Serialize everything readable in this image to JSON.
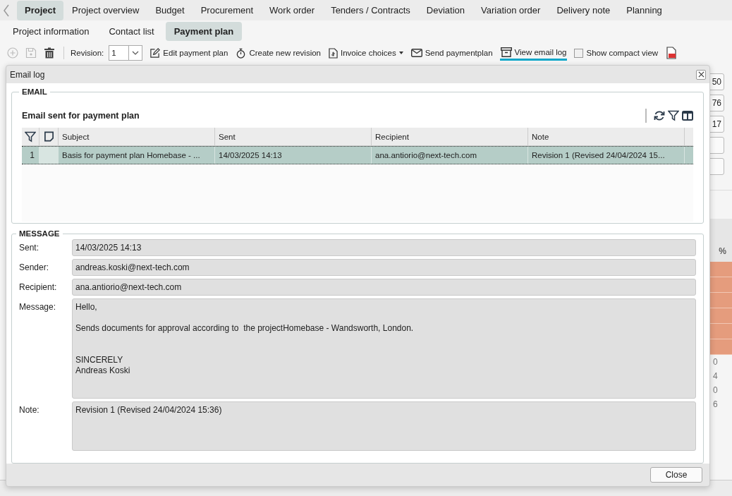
{
  "nav_tabs": [
    {
      "label": "Project",
      "selected": true
    },
    {
      "label": "Project overview",
      "selected": false
    },
    {
      "label": "Budget",
      "selected": false
    },
    {
      "label": "Procurement",
      "selected": false
    },
    {
      "label": "Work order",
      "selected": false
    },
    {
      "label": "Tenders / Contracts",
      "selected": false
    },
    {
      "label": "Deviation",
      "selected": false
    },
    {
      "label": "Variation order",
      "selected": false
    },
    {
      "label": "Delivery note",
      "selected": false
    },
    {
      "label": "Planning",
      "selected": false
    }
  ],
  "sub_tabs": [
    {
      "label": "Project information",
      "selected": false
    },
    {
      "label": "Contact list",
      "selected": false
    },
    {
      "label": "Payment plan",
      "selected": true
    }
  ],
  "toolbar": {
    "icon_buttons": [
      {
        "disabled": true
      },
      {
        "disabled": true
      },
      {
        "disabled": false
      }
    ],
    "revision_label": "Revision:",
    "revision_value": "1",
    "actions": [
      {
        "kind": "button",
        "label": "Edit payment plan",
        "selected": false
      },
      {
        "kind": "button",
        "label": "Create new revision",
        "selected": false
      },
      {
        "kind": "dropdown",
        "label": "Invoice choices",
        "selected": false
      },
      {
        "kind": "button",
        "label": "Send paymentplan",
        "selected": false
      },
      {
        "kind": "button",
        "label": "View email log",
        "selected": true
      },
      {
        "kind": "checkbox",
        "label": "Show compact view",
        "checked": false
      }
    ]
  },
  "background": {
    "summary_fields": [
      "50",
      "76",
      "17"
    ],
    "grid_header": "%",
    "grid_values": [
      "0",
      "4",
      "0",
      "6"
    ]
  },
  "dialog": {
    "title": "Email log",
    "email_section": {
      "legend": "EMAIL",
      "grid_title": "Email sent for payment plan",
      "columns": [
        "Subject",
        "Sent",
        "Recipient",
        "Note"
      ],
      "rows": [
        {
          "number": "1",
          "selected": true,
          "cells": [
            "Basis for payment plan Homebase - ...",
            "14/03/2025 14:13",
            "ana.antiorio@next-tech.com",
            "Revision 1 (Revised 24/04/2024 15..."
          ]
        }
      ]
    },
    "message_section": {
      "legend": "MESSAGE",
      "fields": [
        {
          "kind": "line",
          "label": "Sent:",
          "value": "14/03/2025 14:13"
        },
        {
          "kind": "line",
          "label": "Sender:",
          "value": "andreas.koski@next-tech.com"
        },
        {
          "kind": "line",
          "label": "Recipient:",
          "value": "ana.antiorio@next-tech.com"
        },
        {
          "kind": "multiline",
          "label": "Message:",
          "value": "Hello,\n\nSends documents for approval according to  the projectHomebase - Wandsworth, London.\n\n\nSINCERELY\nAndreas Koski"
        },
        {
          "kind": "note",
          "label": "Note:",
          "value": "Revision 1 (Revised 24/04/2024 15:36)"
        }
      ]
    },
    "buttons": [
      "Close"
    ]
  }
}
